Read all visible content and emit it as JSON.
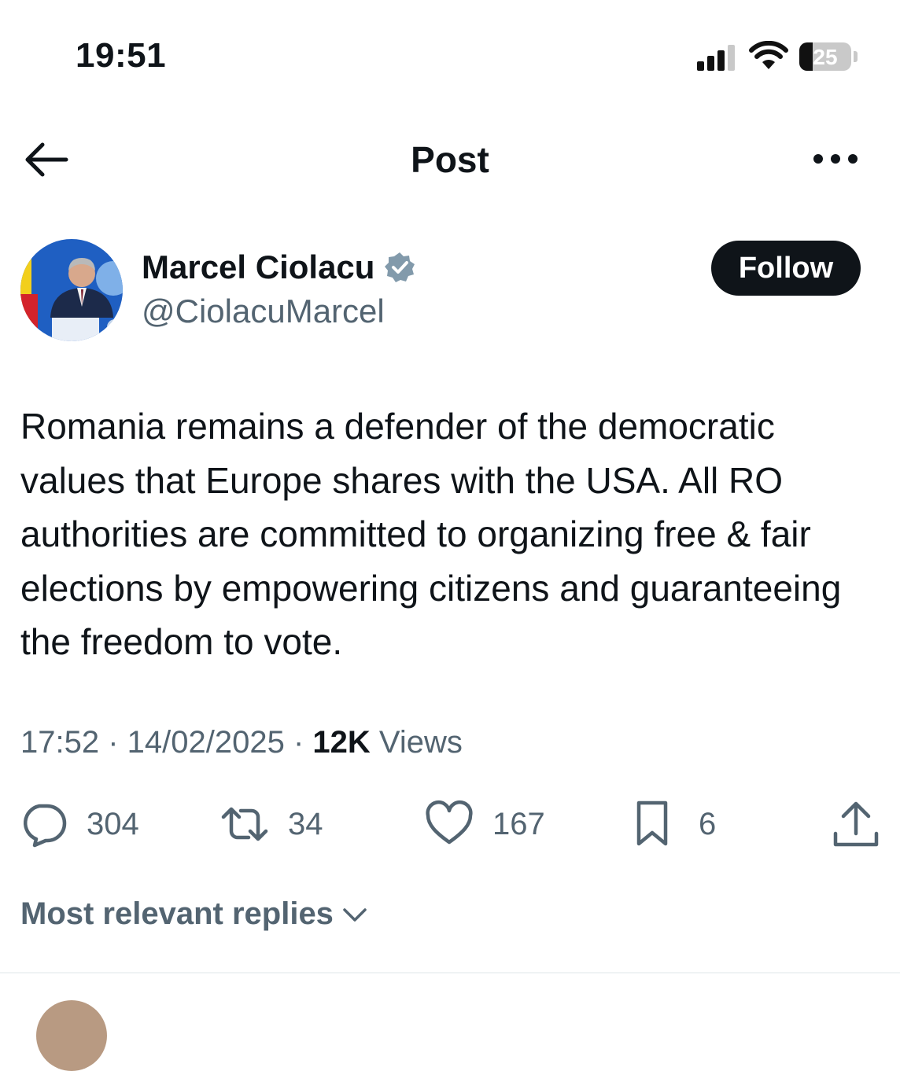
{
  "status_bar": {
    "time": "19:51",
    "battery": "25",
    "battery_level": 0.25
  },
  "header": {
    "title": "Post"
  },
  "author": {
    "name": "Marcel Ciolacu",
    "handle": "@CiolacuMarcel",
    "follow_label": "Follow"
  },
  "post": {
    "text": "Romania remains a defender of the democratic values that Europe shares with the USA. All RO authorities are committed to organizing free & fair elections by empowering citizens and guaranteeing the freedom to vote.",
    "time": "17:52",
    "date": "14/02/2025",
    "separator": " · ",
    "views_count": "12K",
    "views_label": "Views"
  },
  "actions": {
    "replies": "304",
    "reposts": "34",
    "likes": "167",
    "bookmarks": "6"
  },
  "replies_sort": {
    "label": "Most relevant replies"
  },
  "icons": [
    "back-arrow-icon",
    "more-icon",
    "verified-icon",
    "reply-icon",
    "repost-icon",
    "like-icon",
    "bookmark-icon",
    "share-icon",
    "chevron-down-icon",
    "signal-icon",
    "wifi-icon",
    "battery-icon"
  ],
  "colors": {
    "text": "#0f1419",
    "secondary": "#536471",
    "verified": "#829aab",
    "follow_bg": "#0f1419"
  }
}
